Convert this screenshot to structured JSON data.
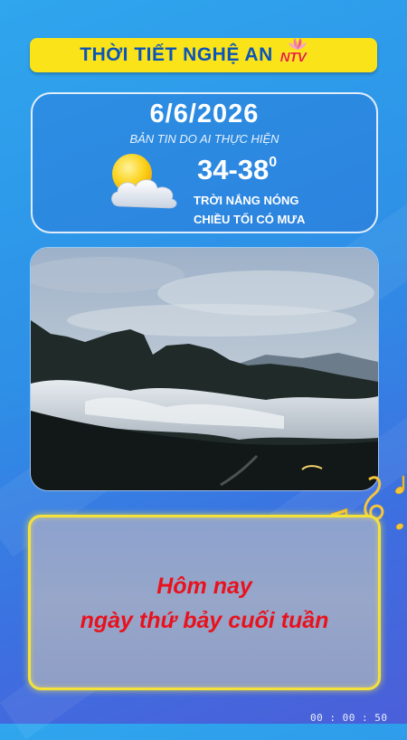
{
  "header": {
    "title": "THỜI TIẾT NGHỆ AN",
    "logo_text": "NTV"
  },
  "forecast": {
    "date": "6/6/2026",
    "subtitle": "BẢN TIN DO AI THỰC HIỆN",
    "temperature": "34-38",
    "degree": "0",
    "condition_line1": "TRỜI NẮNG NÓNG",
    "condition_line2": "CHIỀU TỐI CÓ MƯA",
    "icon": "sun-behind-cloud"
  },
  "message": {
    "line1": "Hôm nay",
    "line2": "ngày thứ bảy cuối tuần"
  },
  "timecode": "00 : 00 : 50",
  "colors": {
    "banner": "#fbe319",
    "title": "#0b55b8",
    "message": "#e8121d",
    "frame": "#f4e23a"
  }
}
